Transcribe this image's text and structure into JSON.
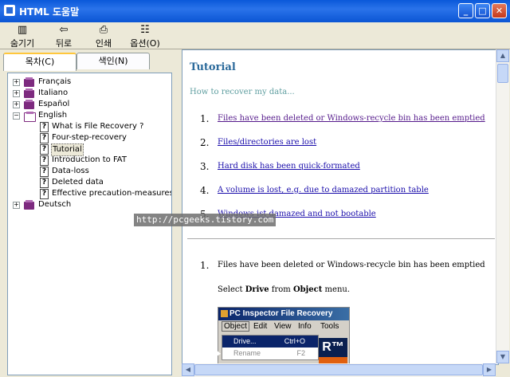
{
  "window": {
    "title": "HTML 도움말",
    "buttons": {
      "minimize": "_",
      "maximize": "□",
      "close": "✕"
    }
  },
  "toolbar": {
    "hide": "숨기기",
    "back": "뒤로",
    "print": "인쇄",
    "options": "옵션(O)"
  },
  "tabs": {
    "contents": "목차(C)",
    "index": "색인(N)"
  },
  "tree": {
    "items": [
      {
        "label": "Français",
        "type": "book",
        "expander": "+"
      },
      {
        "label": "Italiano",
        "type": "book",
        "expander": "+"
      },
      {
        "label": "Español",
        "type": "book",
        "expander": "+"
      },
      {
        "label": "English",
        "type": "book-open",
        "expander": "−"
      },
      {
        "label": "What is File Recovery ?",
        "type": "page"
      },
      {
        "label": "Four-step-recovery",
        "type": "page"
      },
      {
        "label": "Tutorial",
        "type": "page",
        "selected": true
      },
      {
        "label": "Introduction to FAT",
        "type": "page"
      },
      {
        "label": "Data-loss",
        "type": "page"
      },
      {
        "label": "Deleted data",
        "type": "page"
      },
      {
        "label": "Effective precaution-measures",
        "type": "page"
      },
      {
        "label": "Deutsch",
        "type": "book",
        "expander": "+"
      }
    ]
  },
  "content": {
    "title": "Tutorial",
    "subtitle": "How to recover my data...",
    "list": [
      {
        "num": "1.",
        "text": "Files have been deleted or Windows-recycle bin has been emptied"
      },
      {
        "num": "2.",
        "text": "Files/directories are lost"
      },
      {
        "num": "3.",
        "text": "Hard disk has been quick-formated"
      },
      {
        "num": "4.",
        "text": "A volume is lost, e.g. due to damazed partition table"
      },
      {
        "num": "5.",
        "text": "Windows ist damazed and not bootable"
      }
    ],
    "section1": {
      "num": "1.",
      "heading": "Files have been deleted or Windows-recycle bin has been emptied"
    },
    "instruction": {
      "pre": "Select ",
      "b1": "Drive",
      "mid": " from ",
      "b2": "Object",
      "post": " menu."
    },
    "inner": {
      "title": "PC Inspector File Recovery",
      "menu": [
        "Object",
        "Edit",
        "View",
        "Info",
        "Tools"
      ],
      "dropdown": [
        {
          "label": "Drive...",
          "shortcut": "Ctrl+O"
        },
        {
          "label": "Rename",
          "shortcut": "F2"
        }
      ],
      "logo": "R™"
    }
  },
  "watermark": "http://pcgeeks.tistory.com",
  "colors": {
    "title_bar": "#0a58d9",
    "link_visited": "#551a8b",
    "link": "#1a0dab",
    "heading": "#2b6a9b"
  }
}
